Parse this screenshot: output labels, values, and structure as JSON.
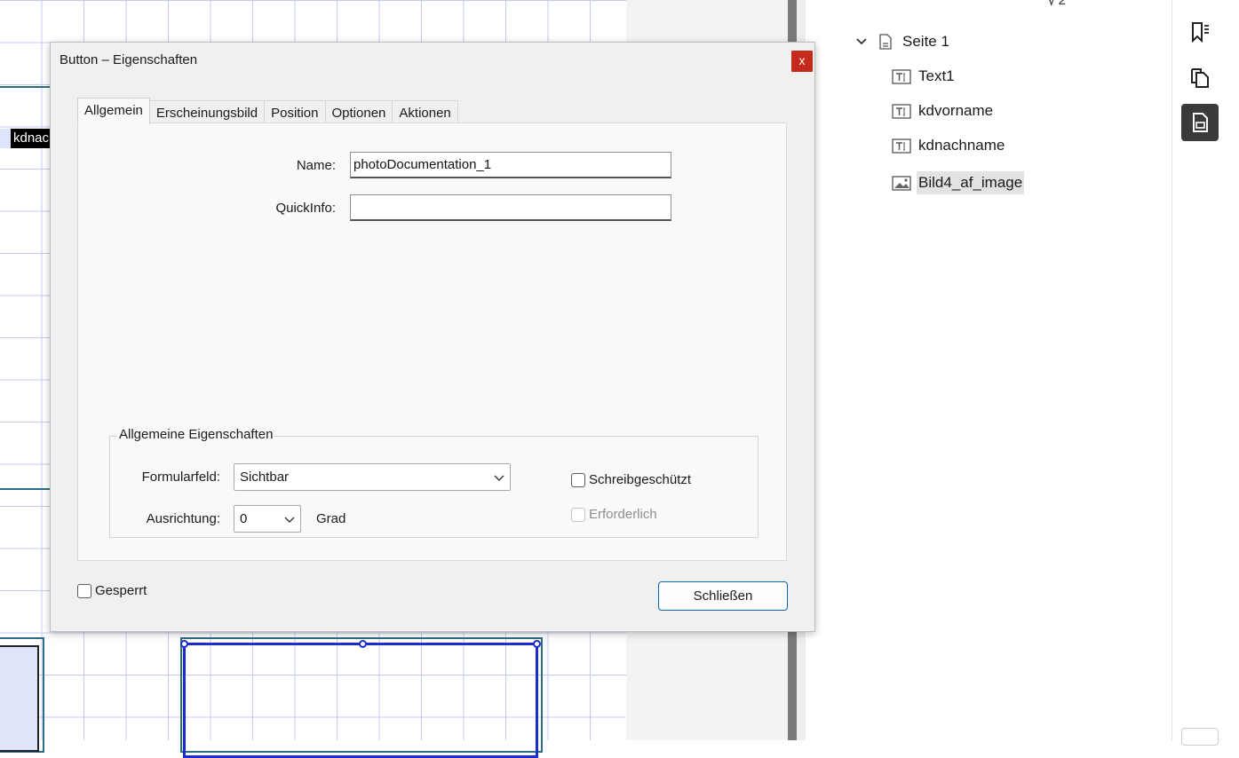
{
  "canvas": {
    "field_tag_text": "kdnac"
  },
  "tree": {
    "top_clip_text": "y 2",
    "items": [
      {
        "label": "Seite 1",
        "icon": "page-icon",
        "expanded": true
      },
      {
        "label": "Text1",
        "icon": "text-field-icon"
      },
      {
        "label": "kdvorname",
        "icon": "text-field-icon"
      },
      {
        "label": "kdnachname",
        "icon": "text-field-icon"
      },
      {
        "label": "Bild4_af_image",
        "icon": "image-field-icon",
        "selected": true
      }
    ]
  },
  "toolstrip": {
    "buttons": [
      "bookmark-icon",
      "pages-icon",
      "fields-icon"
    ],
    "active": "fields-icon"
  },
  "dialog": {
    "title": "Button – Eigenschaften",
    "close_glyph": "x",
    "tabs": [
      "Allgemein",
      "Erscheinungsbild",
      "Position",
      "Optionen",
      "Aktionen"
    ],
    "active_tab": "Allgemein",
    "name_label": "Name:",
    "name_value": "photoDocumentation_1",
    "quickinfo_label": "QuickInfo:",
    "quickinfo_value": "",
    "group_title": "Allgemeine Eigenschaften",
    "formularfeld_label": "Formularfeld:",
    "formularfeld_value": "Sichtbar",
    "ausrichtung_label": "Ausrichtung:",
    "ausrichtung_value": "0",
    "grad_label": "Grad",
    "schreibgeschuetzt_label": "Schreibgeschützt",
    "erforderlich_label": "Erforderlich",
    "gesperrt_label": "Gesperrt",
    "close_button_label": "Schließen"
  },
  "colors": {
    "accent": "#1166b7",
    "close_red": "#c42b1c",
    "selection_blue": "#1a2bd0"
  }
}
